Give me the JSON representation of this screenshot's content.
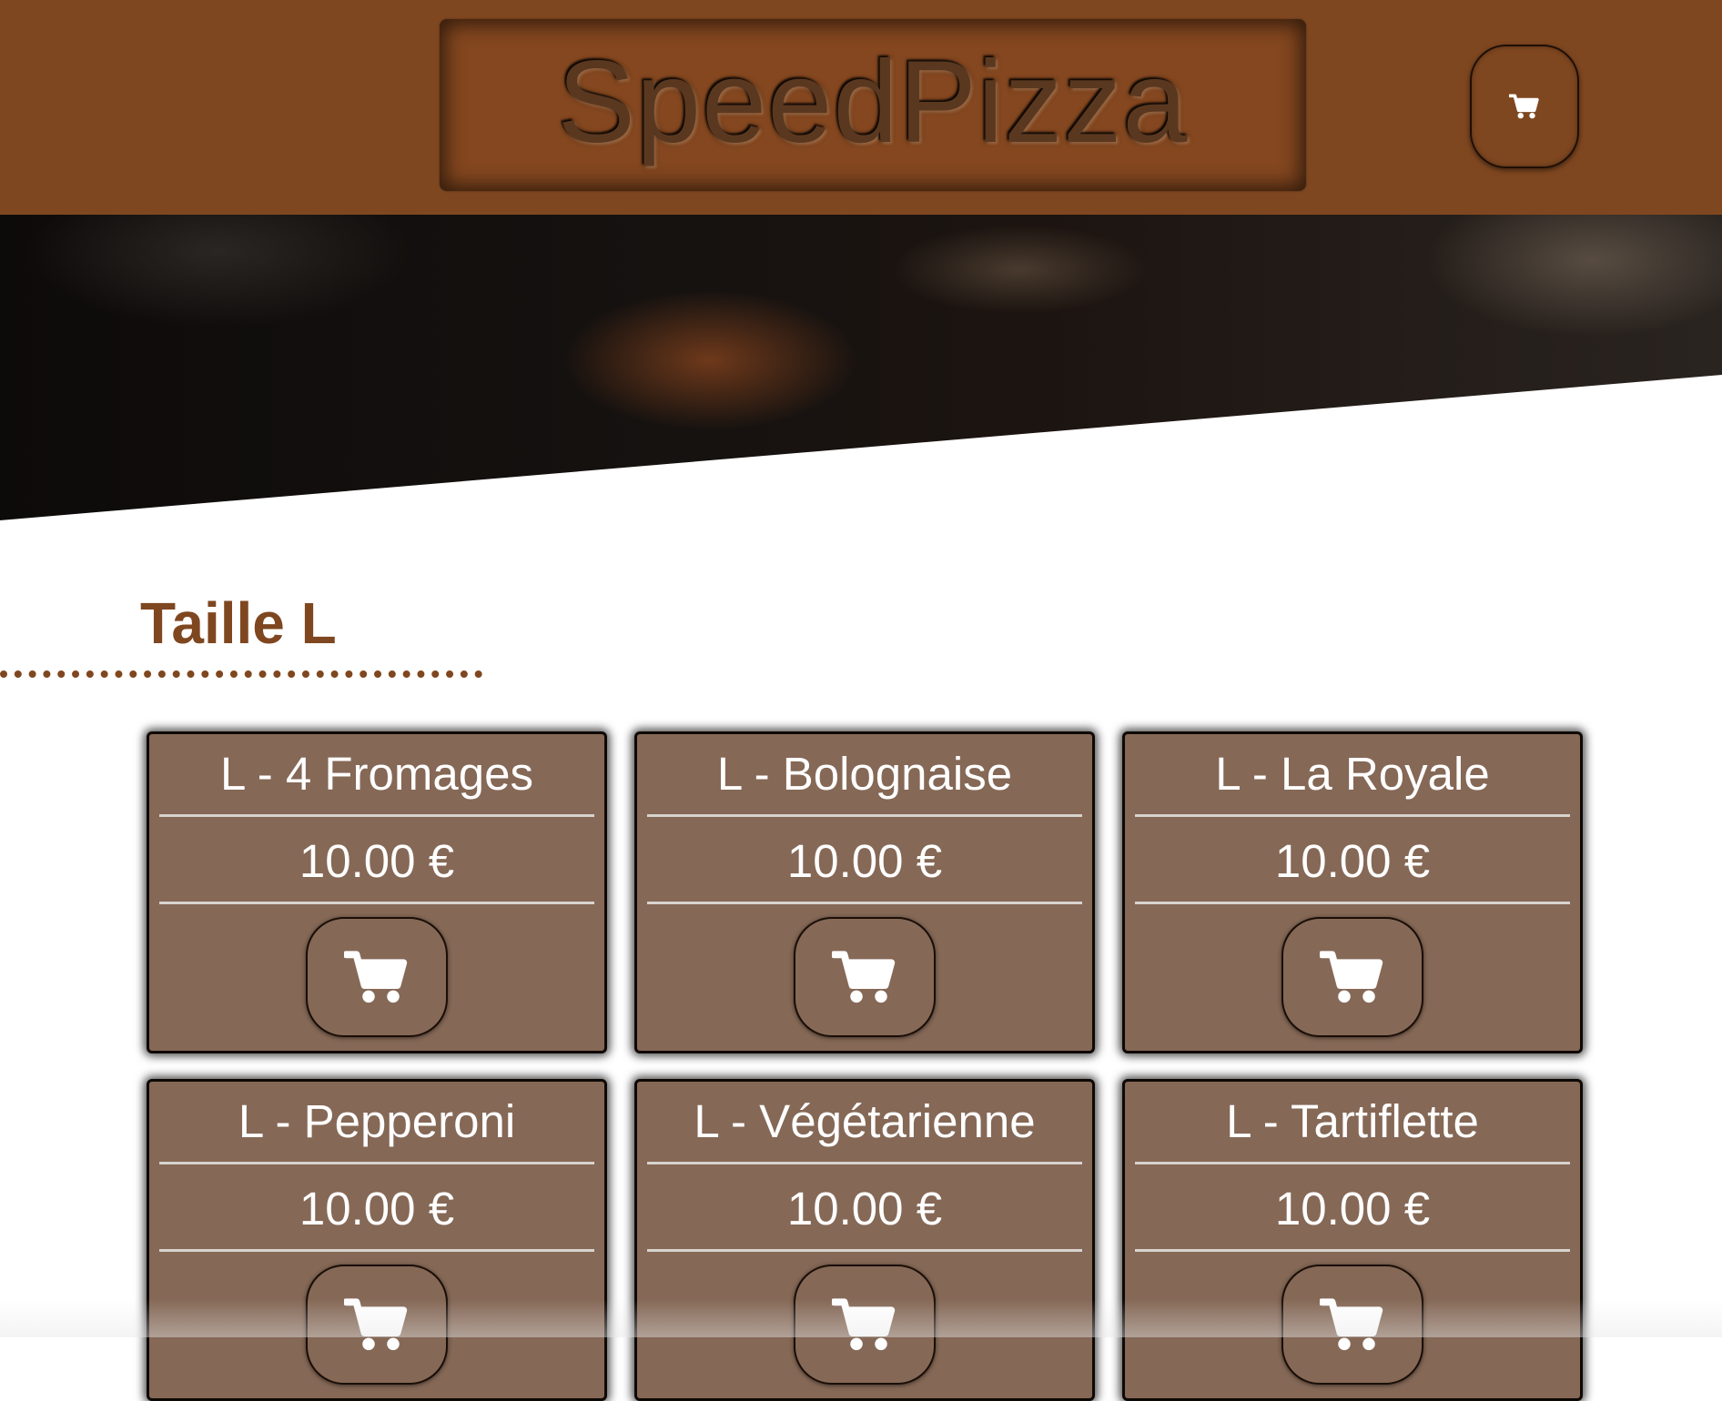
{
  "header": {
    "brand": "SpeedPizza",
    "cart_icon": "cart-icon"
  },
  "section": {
    "title": "Taille L"
  },
  "products": [
    {
      "name": "L - 4 Fromages",
      "price": "10.00 €"
    },
    {
      "name": "L - Bolognaise",
      "price": "10.00 €"
    },
    {
      "name": "L - La Royale",
      "price": "10.00 €"
    },
    {
      "name": "L - Pepperoni",
      "price": "10.00 €"
    },
    {
      "name": "L - Végétarienne",
      "price": "10.00 €"
    },
    {
      "name": "L - Tartiflette",
      "price": "10.00 €"
    }
  ],
  "colors": {
    "brand_brown": "#7f4720",
    "card_bg": "#856856",
    "text_on_card": "#ffffff"
  }
}
